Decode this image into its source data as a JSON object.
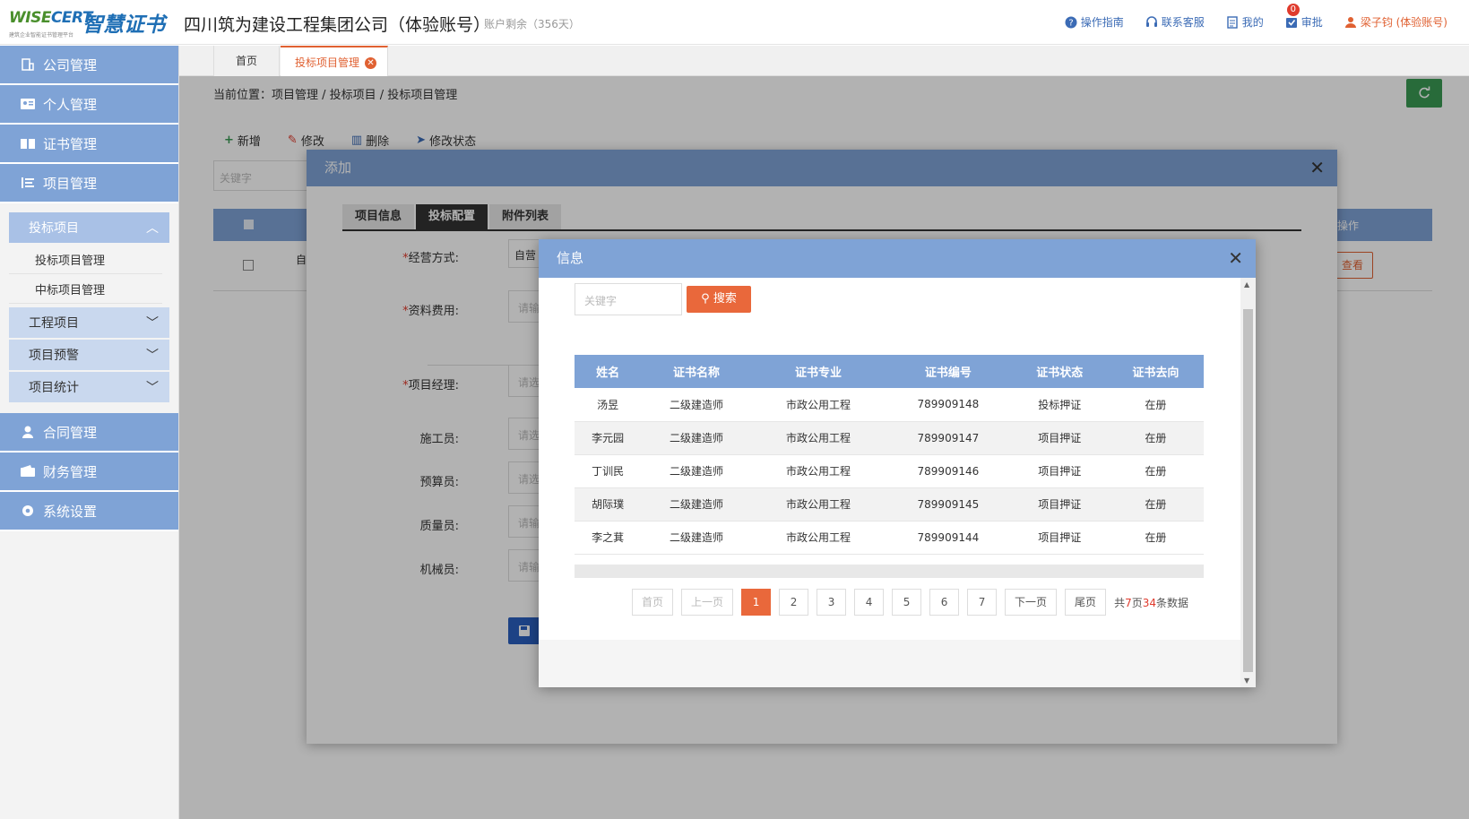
{
  "header": {
    "logo_en_a": "WISE",
    "logo_en_b": "CERT",
    "logo_cn": "智慧证书",
    "logo_small": "建筑企业智能证书管理平台",
    "company": "四川筑为建设工程集团公司（体验账号）",
    "account": "账户剩余（356天）",
    "nav": [
      {
        "label": "操作指南",
        "icon": "help-circle-icon"
      },
      {
        "label": "联系客服",
        "icon": "headset-icon"
      },
      {
        "label": "我的",
        "icon": "document-icon"
      },
      {
        "label": "审批",
        "icon": "checkbox-icon",
        "badge": "0"
      },
      {
        "label": "梁子钧 (体验账号)",
        "icon": "user-icon"
      }
    ]
  },
  "sidebar": {
    "top": [
      {
        "label": "公司管理",
        "icon": "building-icon"
      },
      {
        "label": "个人管理",
        "icon": "id-card-icon"
      },
      {
        "label": "证书管理",
        "icon": "book-icon"
      },
      {
        "label": "项目管理",
        "icon": "list-icon"
      }
    ],
    "project_sub": {
      "group": "投标项目",
      "items": [
        "投标项目管理",
        "中标项目管理"
      ],
      "others": [
        "工程项目",
        "项目预警",
        "项目统计"
      ]
    },
    "bottom": [
      {
        "label": "合同管理",
        "icon": "person-icon"
      },
      {
        "label": "财务管理",
        "icon": "wallet-icon"
      },
      {
        "label": "系统设置",
        "icon": "gear-icon"
      }
    ]
  },
  "tabs": {
    "home": "首页",
    "active": "投标项目管理"
  },
  "main": {
    "breadcrumb": "当前位置：项目管理 / 投标项目 / 投标项目管理",
    "toolbar": [
      "新增",
      "修改",
      "删除",
      "修改状态"
    ],
    "search_placeholder": "关键字",
    "op_header": "操作",
    "row_text": "自",
    "view_btn": "查看"
  },
  "modal_add": {
    "title": "添加",
    "tabs": [
      "项目信息",
      "投标配置",
      "附件列表"
    ],
    "fields": [
      {
        "label": "经营方式:",
        "required": true,
        "value": "自营"
      },
      {
        "label": "资料费用:",
        "required": true,
        "value": "请输"
      },
      {
        "label": "项目经理:",
        "required": true,
        "value": "请选"
      },
      {
        "label": "施工员:",
        "required": false,
        "value": "请选"
      },
      {
        "label": "预算员:",
        "required": false,
        "value": "请选"
      },
      {
        "label": "质量员:",
        "required": false,
        "value": "请输"
      },
      {
        "label": "机械员:",
        "required": false,
        "value": "请输"
      }
    ]
  },
  "modal_info": {
    "title": "信息",
    "search_placeholder": "关键字",
    "search_btn": "搜索",
    "columns": [
      "姓名",
      "证书名称",
      "证书专业",
      "证书编号",
      "证书状态",
      "证书去向"
    ],
    "rows": [
      [
        "汤昱",
        "二级建造师",
        "市政公用工程",
        "789909148",
        "投标押证",
        "在册"
      ],
      [
        "李元园",
        "二级建造师",
        "市政公用工程",
        "789909147",
        "项目押证",
        "在册"
      ],
      [
        "丁训民",
        "二级建造师",
        "市政公用工程",
        "789909146",
        "项目押证",
        "在册"
      ],
      [
        "胡际璞",
        "二级建造师",
        "市政公用工程",
        "789909145",
        "项目押证",
        "在册"
      ],
      [
        "李之萁",
        "二级建造师",
        "市政公用工程",
        "789909144",
        "项目押证",
        "在册"
      ]
    ],
    "pager": {
      "first": "首页",
      "prev": "上一页",
      "pages": [
        "1",
        "2",
        "3",
        "4",
        "5",
        "6",
        "7"
      ],
      "current": "1",
      "next": "下一页",
      "last": "尾页",
      "info_a": "共",
      "info_pages": "7",
      "info_b": "页",
      "info_count": "34",
      "info_c": "条数据"
    }
  }
}
